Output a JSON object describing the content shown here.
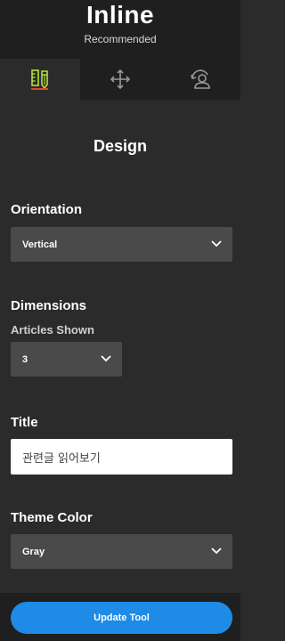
{
  "header": {
    "title": "Inline",
    "subtitle": "Recommended"
  },
  "tabs": [
    {
      "icon": "ruler-pencil-icon",
      "active": true,
      "color": "#b4e03c"
    },
    {
      "icon": "move-arrows-icon",
      "active": false,
      "color": "#9a9a9a"
    },
    {
      "icon": "user-settings-icon",
      "active": false,
      "color": "#9a9a9a"
    }
  ],
  "section_title": "Design",
  "orientation": {
    "label": "Orientation",
    "value": "Vertical"
  },
  "dimensions": {
    "label": "Dimensions",
    "articles_label": "Articles Shown",
    "articles_value": "3"
  },
  "title_field": {
    "label": "Title",
    "value": "관련글 읽어보기"
  },
  "theme_color": {
    "label": "Theme Color",
    "value": "Gray"
  },
  "footer": {
    "update_label": "Update Tool",
    "button_color": "#1e8be6"
  }
}
